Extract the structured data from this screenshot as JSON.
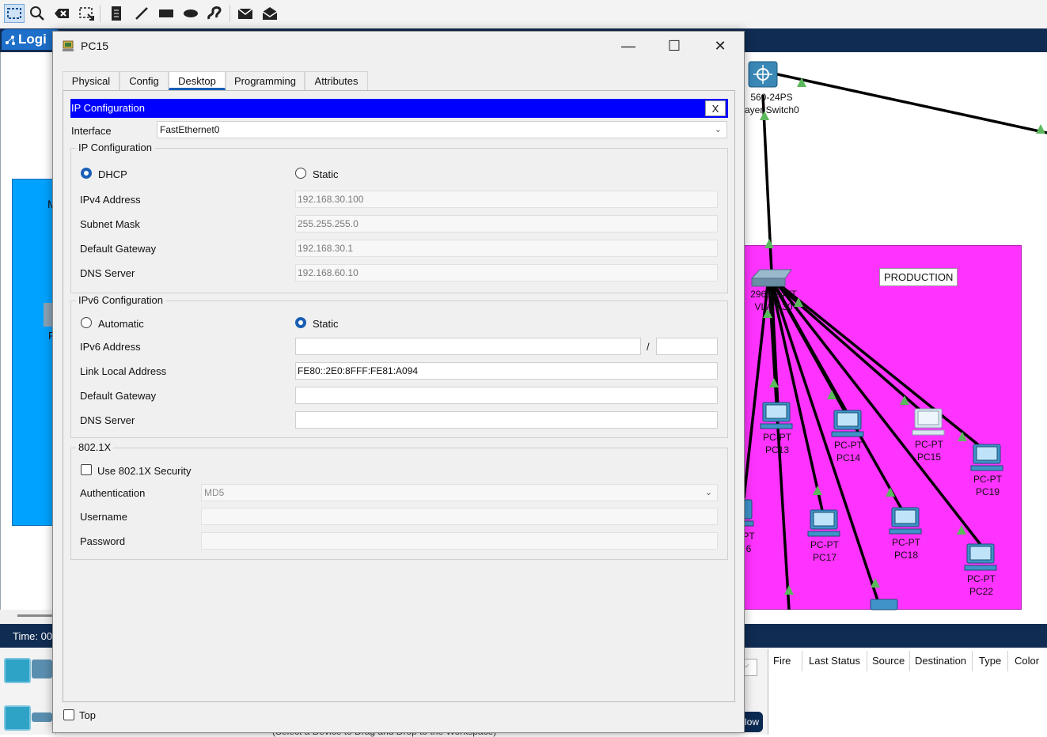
{
  "app": {
    "toolbar_icons": [
      "select-icon",
      "inspect-icon",
      "delete-icon",
      "resize-icon",
      "note-icon",
      "line-icon",
      "rectangle-icon",
      "ellipse-icon",
      "freeform-icon",
      "simple-pdu-icon",
      "complex-pdu-icon"
    ],
    "logical_tab_label": "Logi",
    "time_label": "Time: 00",
    "area_label_m": "M",
    "area_letter_p": "P",
    "production_label": "PRODUCTION",
    "switch_l3_model": "560-24PS",
    "switch_l3_name": "ayer Switch0",
    "switch_l2_model": "2960-24TT",
    "switch_l2_name": "VLAN 30",
    "devices": [
      {
        "model": "PC-PT",
        "name": "PC13"
      },
      {
        "model": "PC-PT",
        "name": "PC14"
      },
      {
        "model": "PC-PT",
        "name": "PC15"
      },
      {
        "model": "PC-PT",
        "name": "PC19"
      },
      {
        "model": "PC-PT",
        "name": "PC17"
      },
      {
        "model": "PC-PT",
        "name": "PC18"
      },
      {
        "model": "PC-PT",
        "name": "PC22"
      },
      {
        "model": "PT",
        "name": "6"
      }
    ],
    "pdu_headers": [
      "Fire",
      "Last Status",
      "Source",
      "Destination",
      "Type",
      "Color"
    ],
    "new_button_label": "low",
    "hint_text": "(Select a Device to Drag and Drop to the Workspace)",
    "colors": {
      "production_area": "#ff33ff",
      "blue_area": "#00a2ff",
      "dark_bar": "#102c52"
    }
  },
  "dialog": {
    "title": "PC15",
    "controls": {
      "minimize": "—",
      "maximize": "☐",
      "close": "✕"
    },
    "tabs": [
      "Physical",
      "Config",
      "Desktop",
      "Programming",
      "Attributes"
    ],
    "active_tab": "Desktop",
    "ip_config": {
      "header": "IP Configuration",
      "close_label": "X",
      "interface_label": "Interface",
      "interface_value": "FastEthernet0",
      "ipv4_group": {
        "title": "IP Configuration",
        "dhcp_label": "DHCP",
        "static_label": "Static",
        "mode": "DHCP",
        "ipv4_label": "IPv4 Address",
        "ipv4_value": "192.168.30.100",
        "mask_label": "Subnet Mask",
        "mask_value": "255.255.255.0",
        "gateway_label": "Default Gateway",
        "gateway_value": "192.168.30.1",
        "dns_label": "DNS Server",
        "dns_value": "192.168.60.10"
      },
      "ipv6_group": {
        "title": "IPv6 Configuration",
        "automatic_label": "Automatic",
        "static_label": "Static",
        "mode": "Static",
        "ipv6_label": "IPv6 Address",
        "ipv6_value": "",
        "prefix_separator": "/",
        "prefix_value": "",
        "link_local_label": "Link Local Address",
        "link_local_value": "FE80::2E0:8FFF:FE81:A094",
        "gateway_label": "Default Gateway",
        "gateway_value": "",
        "dns_label": "DNS Server",
        "dns_value": ""
      },
      "dot1x_group": {
        "title": "802.1X",
        "use_security_label": "Use 802.1X Security",
        "use_security_checked": false,
        "auth_label": "Authentication",
        "auth_value": "MD5",
        "username_label": "Username",
        "username_value": "",
        "password_label": "Password",
        "password_value": ""
      }
    },
    "top_label": "Top",
    "top_checked": false
  }
}
